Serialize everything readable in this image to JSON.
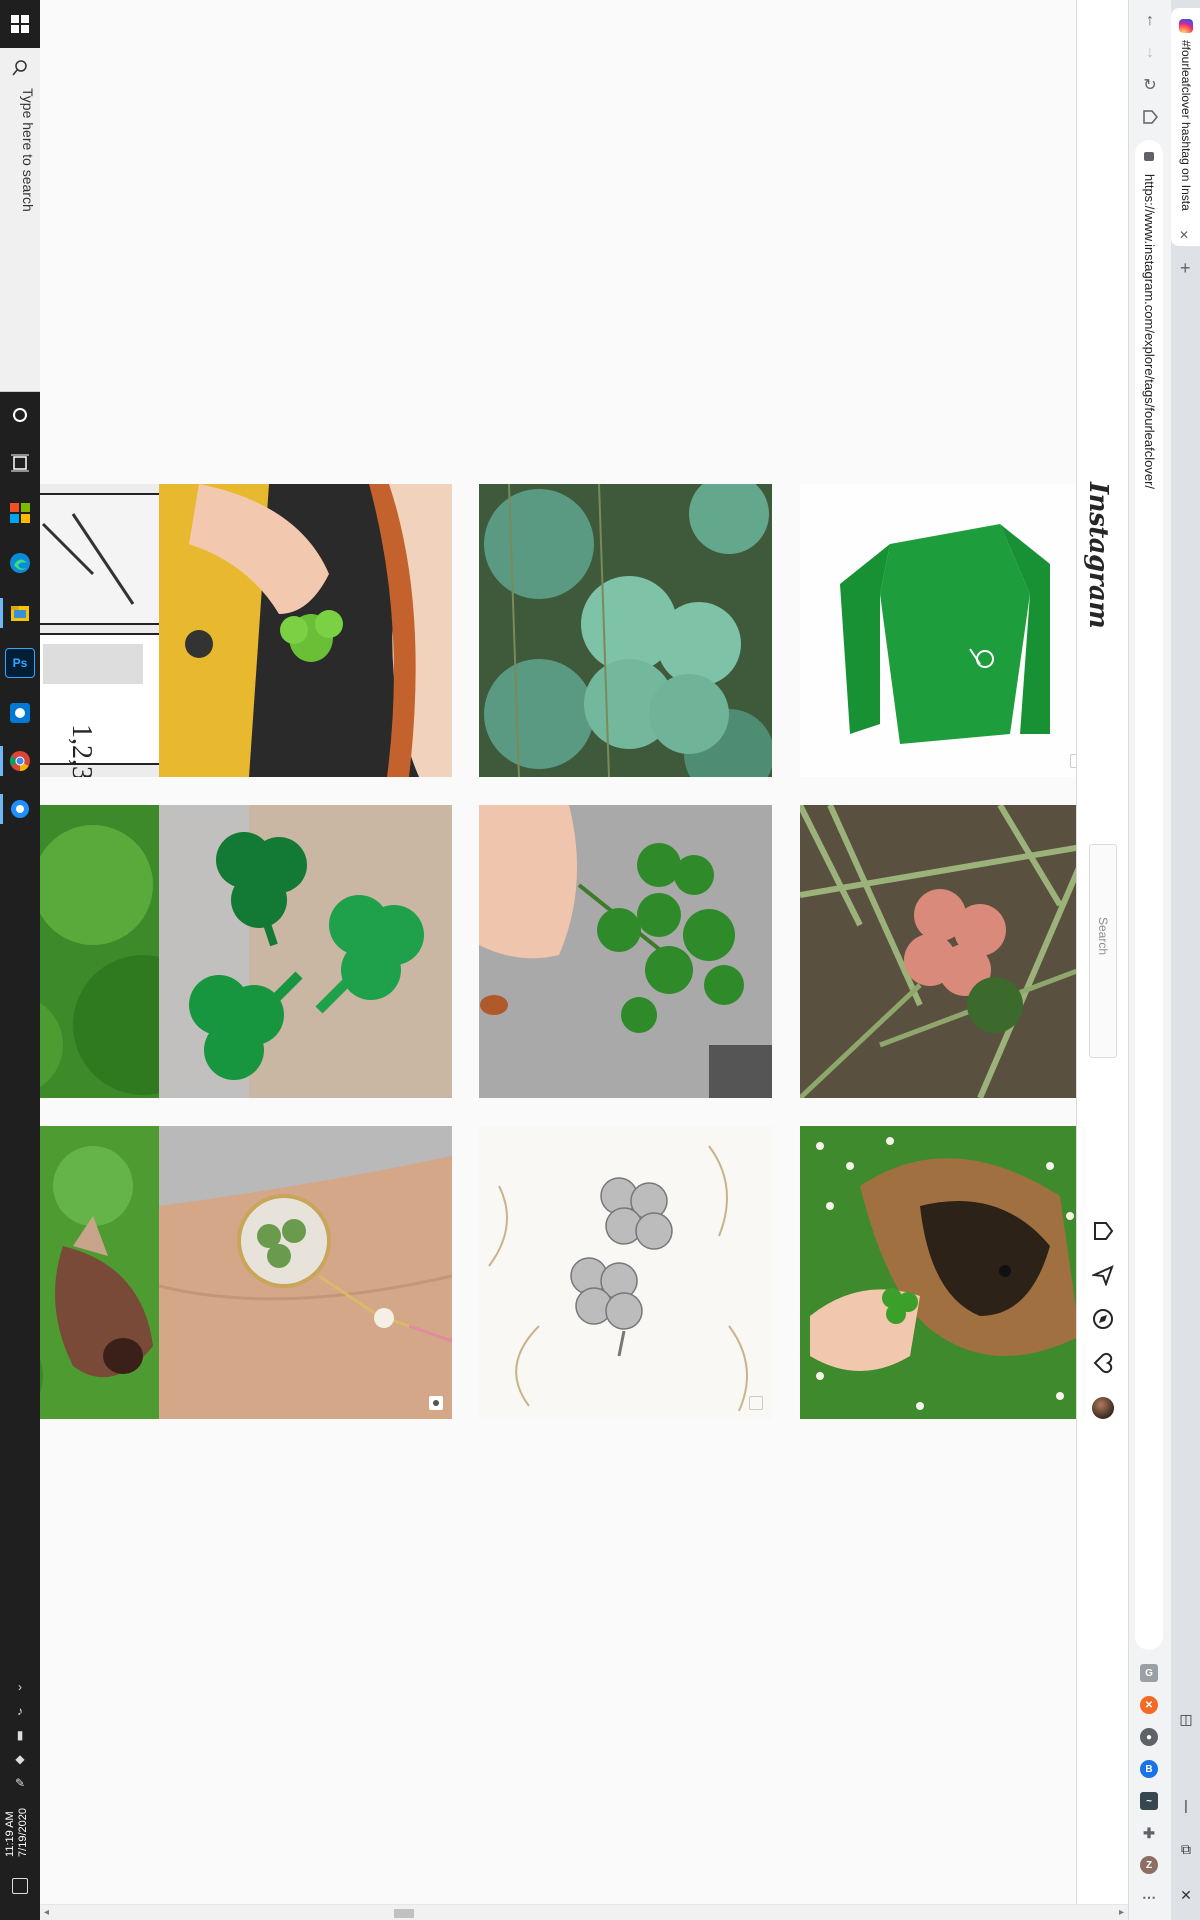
{
  "taskbar": {
    "search_placeholder": "Type here to search",
    "apps": [
      "edge",
      "file-explorer",
      "photoshop",
      "microsoft-store",
      "chrome",
      "settings"
    ],
    "clock_time": "11:19 AM",
    "clock_date": "7/19/2020"
  },
  "browser": {
    "tab_title": "#fourleafclover hashtag on Insta",
    "url": "https://www.instagram.com/explore/tags/fourleafclover/",
    "new_tab_symbol": "+",
    "close_symbol": "✕"
  },
  "instagram": {
    "logo": "Instagram",
    "search_placeholder": "Search",
    "nav_icons": [
      "home-icon",
      "direct-icon",
      "explore-icon",
      "activity-heart-icon",
      "profile-avatar"
    ]
  },
  "posts": [
    {
      "row": 0,
      "col": 0,
      "description": "comic-page"
    },
    {
      "row": 0,
      "col": 1,
      "description": "hand-holding-clover-in-car"
    },
    {
      "row": 0,
      "col": 2,
      "description": "clover-leaves-closeup"
    },
    {
      "row": 0,
      "col": 3,
      "description": "green-jersey",
      "badge": "multi"
    },
    {
      "row": 1,
      "col": 0,
      "description": "green-grass"
    },
    {
      "row": 1,
      "col": 1,
      "description": "green-shamrock-cutouts"
    },
    {
      "row": 1,
      "col": 2,
      "description": "hand-holding-four-leaf-clover"
    },
    {
      "row": 1,
      "col": 3,
      "description": "pink-clover-in-grass"
    },
    {
      "row": 2,
      "col": 0,
      "description": "dog-on-grass"
    },
    {
      "row": 2,
      "col": 1,
      "description": "clover-pendant-in-hand",
      "badge": "video"
    },
    {
      "row": 2,
      "col": 2,
      "description": "silver-clover-earrings",
      "badge": "multi"
    },
    {
      "row": 2,
      "col": 3,
      "description": "dog-with-clover"
    }
  ]
}
